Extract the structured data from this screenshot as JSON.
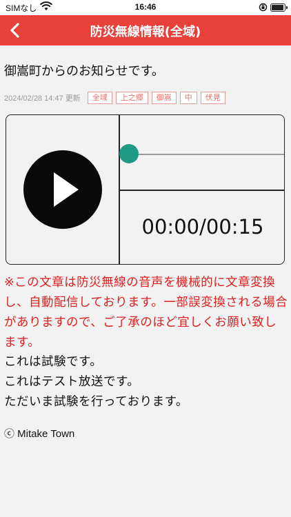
{
  "status_bar": {
    "carrier": "SIMなし",
    "time": "16:46"
  },
  "nav": {
    "title": "防災無線情報(全域)"
  },
  "message": {
    "intro": "御嵩町からのお知らせです。",
    "datetime": "2024/02/28 14:47 更新",
    "tags": [
      "全域",
      "上之郷",
      "御嵩",
      "中",
      "伏見"
    ]
  },
  "player": {
    "time_display": "00:00/00:15",
    "progress": 0
  },
  "notice": "※この文章は防災無線の音声を機械的に文章変換し、自動配信しております。一部誤変換される場合がありますので、ご了承のほど宜しくお願い致します。",
  "body_lines": [
    "これは試験です。",
    "これはテスト放送です。",
    "ただいま試験を行っております。"
  ],
  "copyright": "ⓒ Mitake Town",
  "colors": {
    "accent": "#e8413a",
    "notice": "#e02020",
    "seek_thumb": "#1e9a86"
  }
}
